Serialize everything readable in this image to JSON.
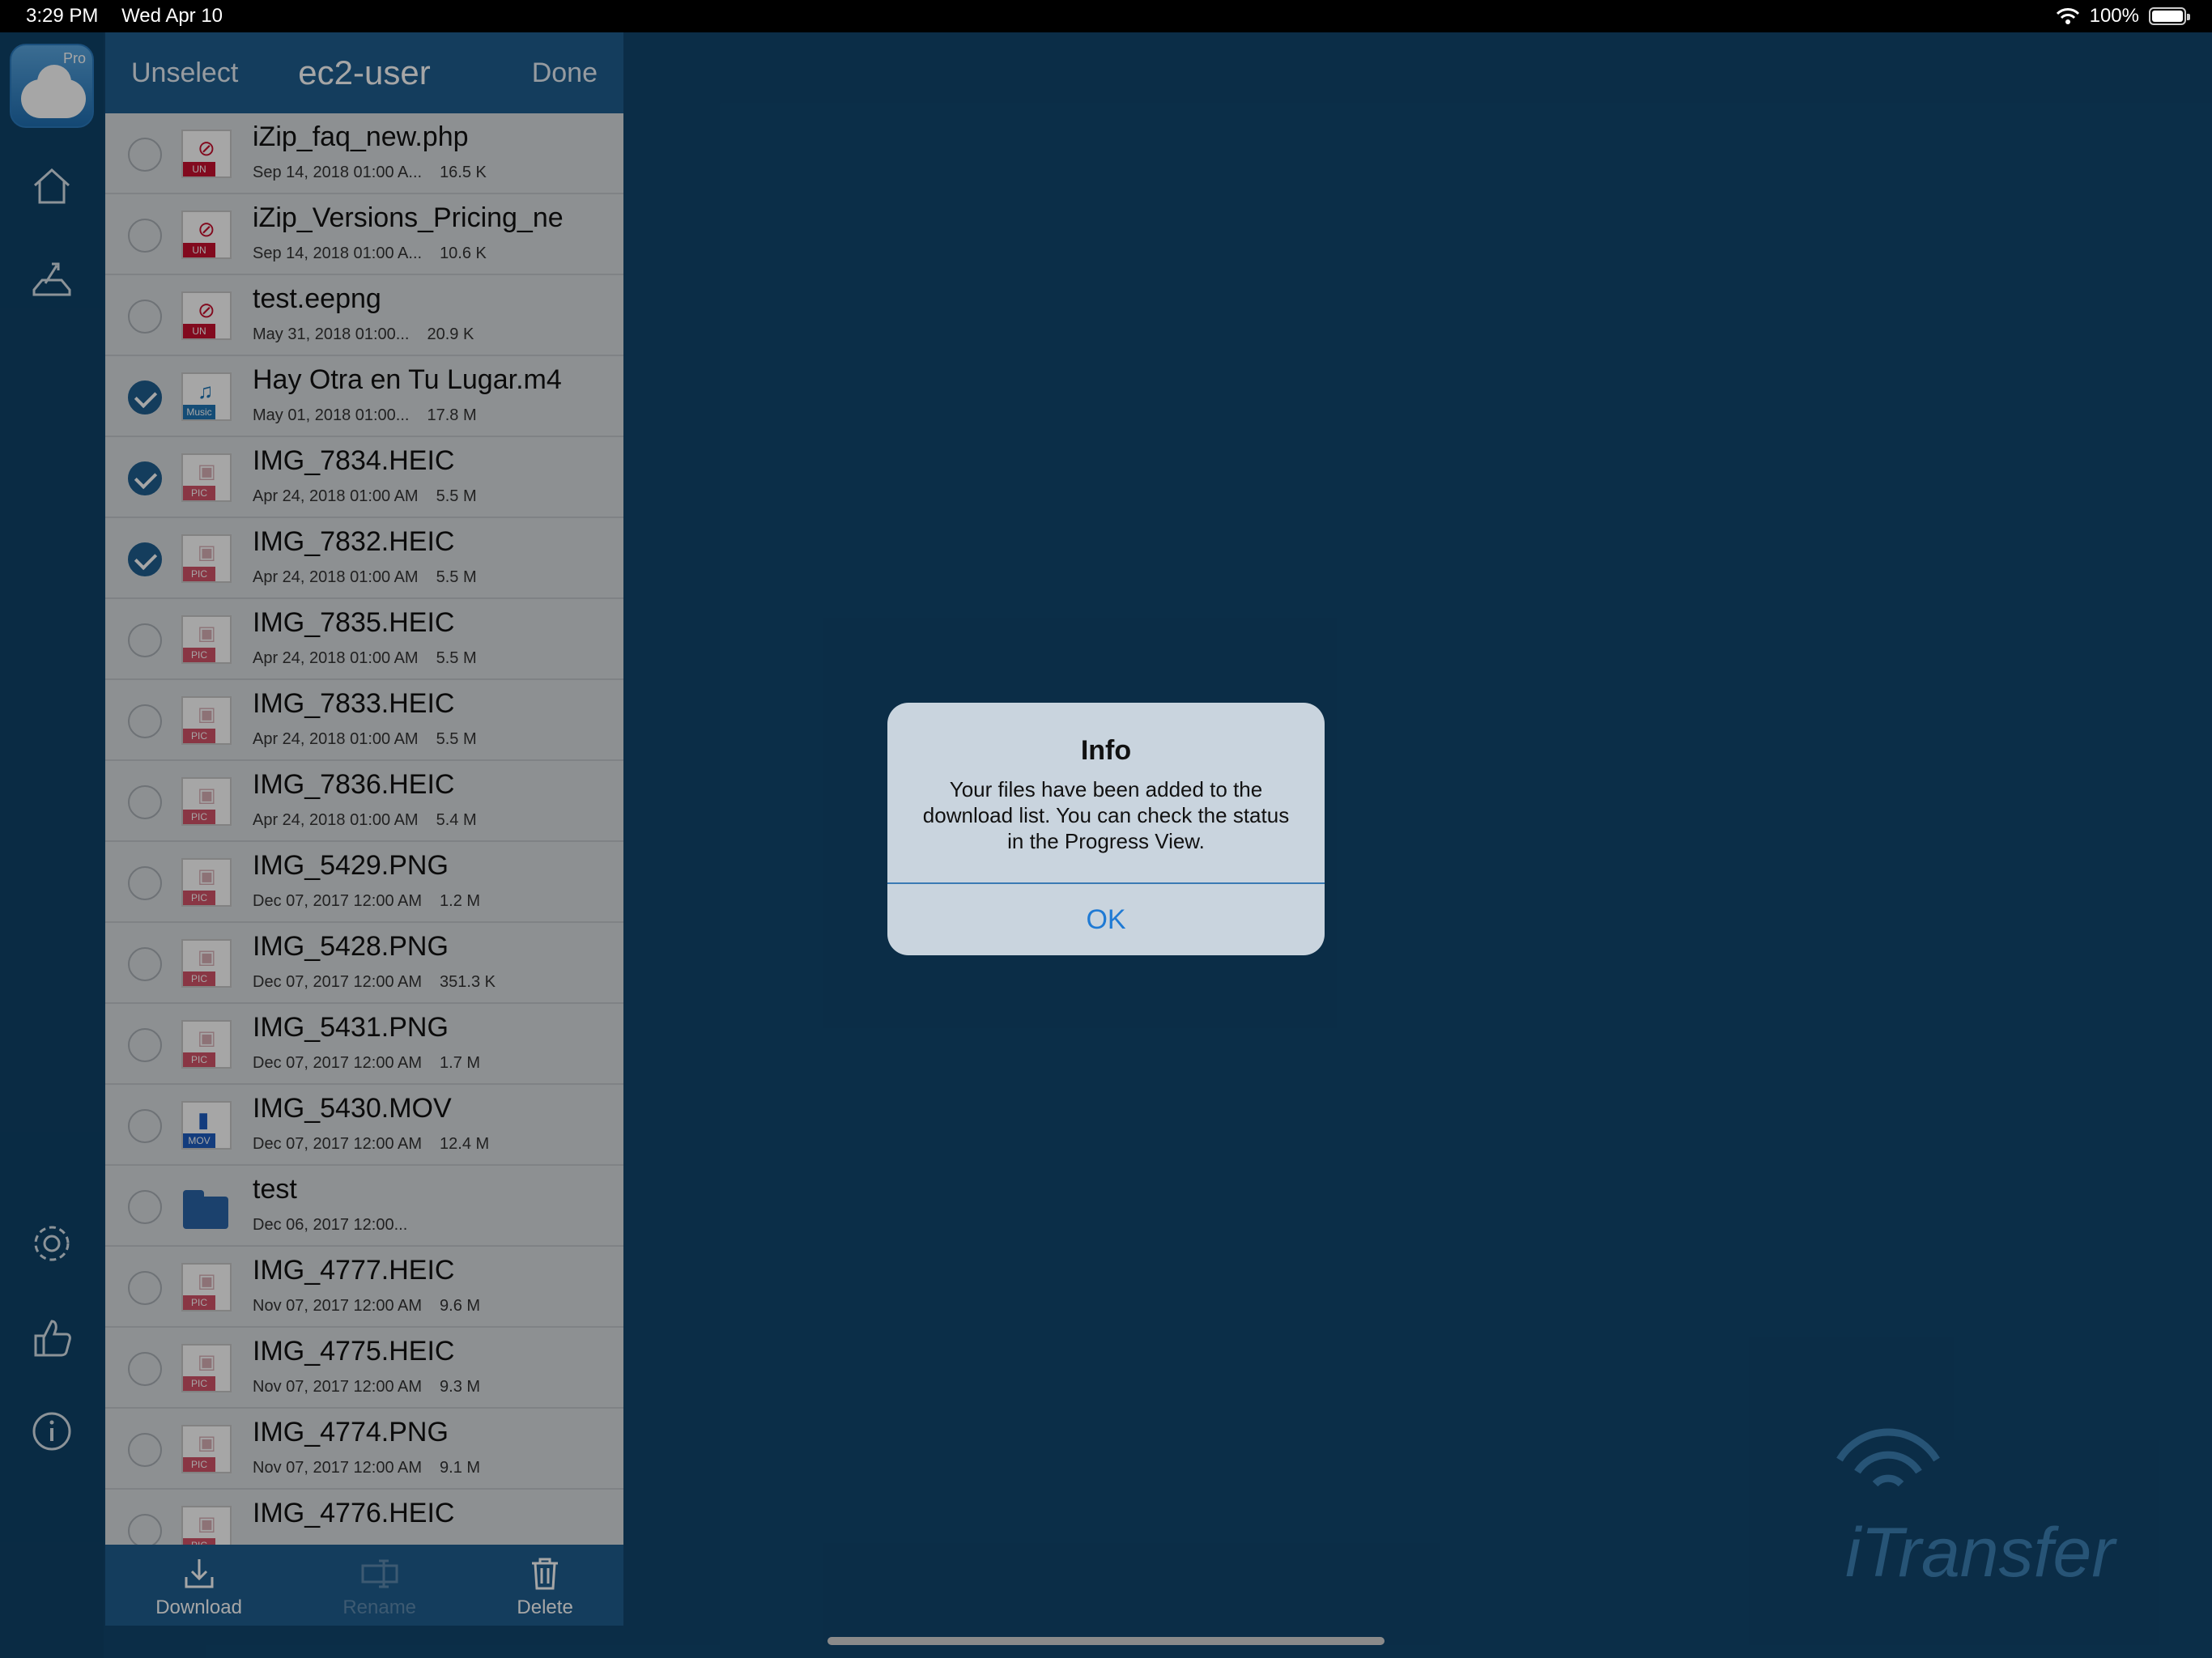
{
  "status": {
    "time": "3:29 PM",
    "date": "Wed Apr 10",
    "battery": "100%"
  },
  "rail": {
    "pro_label": "Pro"
  },
  "panel": {
    "left_button": "Unselect",
    "title": "ec2-user",
    "right_button": "Done",
    "files": [
      {
        "name": "iZip_faq_new.php",
        "date": "Sep 14, 2018 01:00 A...",
        "size": "16.5 K",
        "type_tag": "UN",
        "checked": false
      },
      {
        "name": "iZip_Versions_Pricing_ne",
        "date": "Sep 14, 2018 01:00 A...",
        "size": "10.6 K",
        "type_tag": "UN",
        "checked": false
      },
      {
        "name": "test.eepng",
        "date": "May 31, 2018 01:00...",
        "size": "20.9 K",
        "type_tag": "UN",
        "checked": false
      },
      {
        "name": "Hay Otra en Tu Lugar.m4",
        "date": "May 01, 2018 01:00...",
        "size": "17.8 M",
        "type_tag": "Music",
        "checked": true
      },
      {
        "name": "IMG_7834.HEIC",
        "date": "Apr 24, 2018 01:00 AM",
        "size": "5.5 M",
        "type_tag": "PIC",
        "checked": true
      },
      {
        "name": "IMG_7832.HEIC",
        "date": "Apr 24, 2018 01:00 AM",
        "size": "5.5 M",
        "type_tag": "PIC",
        "checked": true
      },
      {
        "name": "IMG_7835.HEIC",
        "date": "Apr 24, 2018 01:00 AM",
        "size": "5.5 M",
        "type_tag": "PIC",
        "checked": false
      },
      {
        "name": "IMG_7833.HEIC",
        "date": "Apr 24, 2018 01:00 AM",
        "size": "5.5 M",
        "type_tag": "PIC",
        "checked": false
      },
      {
        "name": "IMG_7836.HEIC",
        "date": "Apr 24, 2018 01:00 AM",
        "size": "5.4 M",
        "type_tag": "PIC",
        "checked": false
      },
      {
        "name": "IMG_5429.PNG",
        "date": "Dec 07, 2017 12:00 AM",
        "size": "1.2 M",
        "type_tag": "PIC",
        "checked": false
      },
      {
        "name": "IMG_5428.PNG",
        "date": "Dec 07, 2017 12:00 AM",
        "size": "351.3 K",
        "type_tag": "PIC",
        "checked": false
      },
      {
        "name": "IMG_5431.PNG",
        "date": "Dec 07, 2017 12:00 AM",
        "size": "1.7 M",
        "type_tag": "PIC",
        "checked": false
      },
      {
        "name": "IMG_5430.MOV",
        "date": "Dec 07, 2017 12:00 AM",
        "size": "12.4 M",
        "type_tag": "MOV",
        "checked": false
      },
      {
        "name": "test",
        "date": "Dec 06, 2017 12:00...",
        "size": "",
        "type_tag": "",
        "checked": false
      },
      {
        "name": "IMG_4777.HEIC",
        "date": "Nov 07, 2017 12:00 AM",
        "size": "9.6 M",
        "type_tag": "PIC",
        "checked": false
      },
      {
        "name": "IMG_4775.HEIC",
        "date": "Nov 07, 2017 12:00 AM",
        "size": "9.3 M",
        "type_tag": "PIC",
        "checked": false
      },
      {
        "name": "IMG_4774.PNG",
        "date": "Nov 07, 2017 12:00 AM",
        "size": "9.1 M",
        "type_tag": "PIC",
        "checked": false
      },
      {
        "name": "IMG_4776.HEIC",
        "date": "",
        "size": "",
        "type_tag": "PIC",
        "checked": false
      }
    ],
    "toolbar": {
      "download": "Download",
      "rename": "Rename",
      "delete": "Delete"
    }
  },
  "dialog": {
    "title": "Info",
    "message": "Your files have been added to the download list. You can check the status in the Progress View.",
    "ok": "OK"
  },
  "watermark": "iTransfer"
}
